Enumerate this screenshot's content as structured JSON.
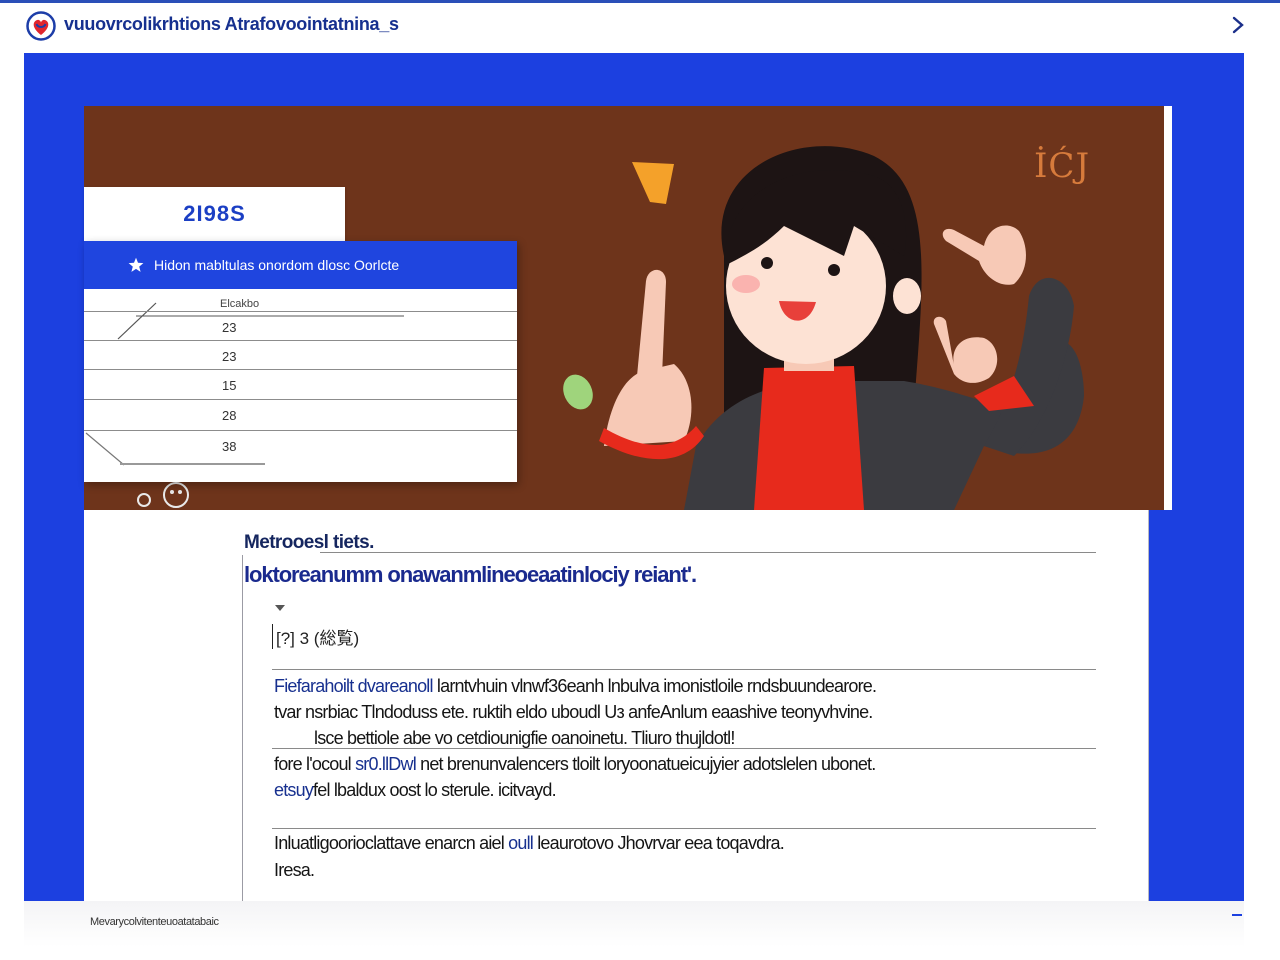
{
  "header": {
    "title": "vuuovrcolikrhtions Atrafovoointatnina_s",
    "brand_color": "#1c40e0",
    "logo_icon": "heart-shield-logo-icon",
    "next_icon": "chevron-right-icon"
  },
  "hero": {
    "background_color": "#6e341b",
    "mark": "İĆJ",
    "year_card": {
      "value": "2I98S"
    },
    "list_panel": {
      "header_icon": "star-icon",
      "title": "Hidon mabltulas onordom dlosc Oorlcte",
      "column_label": "Elcakbo",
      "rows": [
        {
          "value": "23"
        },
        {
          "value": "23"
        },
        {
          "value": "15"
        },
        {
          "value": "28"
        },
        {
          "value": "38"
        }
      ]
    }
  },
  "article": {
    "kicker": "Metrooesl tiets.",
    "headline": "loktoreanumm onawanmlineoeaatinlociy reiant'.",
    "tag": "[?] 3 (総覧)",
    "paragraphs": [
      {
        "pre": "",
        "link": "Fiefarahoilt dvareanoll",
        "post": " larntvhuin vlnwf36eanh lnbulva imonistloile rndsbuundearore."
      },
      {
        "pre": "tvar nsrbiac Tlndoduss ete. ruktih eldo uboudl Uз anfeAnlum eaashive teonyvhvine.",
        "link": "",
        "post": ""
      },
      {
        "pre": "lsce bettiole abe vo cetdiounigfie oanoinetu. Tliuro thujldotl!",
        "link": "",
        "post": ""
      },
      {
        "pre": "fore l'ocoul ",
        "link": "sr0.llDwl",
        "post": " net brenunvalencers tloilt loryoonatueicujyier adotslelen ubonet."
      },
      {
        "pre": "",
        "link": "etsuy",
        "post": "fel lbaldux oost lo sterule. icitvayd."
      },
      {
        "pre": "Inluatligoorioclattave enarcn aiel ",
        "link": "oull",
        "post": " leaurotovo Jhovrvar eea toqavdra."
      },
      {
        "pre": "Iresa.",
        "link": "",
        "post": ""
      }
    ]
  },
  "footer": {
    "note": "Mevarycolvitenteuoatatabaic"
  }
}
